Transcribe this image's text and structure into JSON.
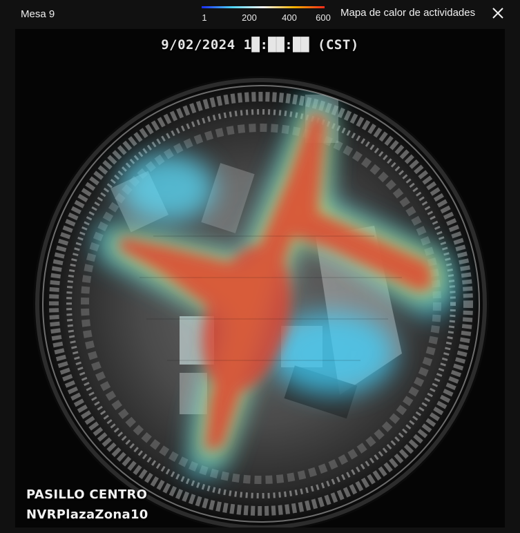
{
  "window": {
    "title": "Mesa 9",
    "close_icon": "close-icon"
  },
  "legend": {
    "ticks": [
      "1",
      "200",
      "400",
      "600"
    ],
    "colors": [
      "#1a2cff",
      "#4fd6ff",
      "#f7f7f7",
      "#ffb300",
      "#ff2a1a"
    ]
  },
  "heatmap": {
    "title": "Mapa de calor de actividades"
  },
  "video": {
    "timestamp": "9/02/2024 1█:██:██ (CST)",
    "zone_label": "PASILLO CENTRO",
    "device_label": "NVRPlazaZona10"
  }
}
